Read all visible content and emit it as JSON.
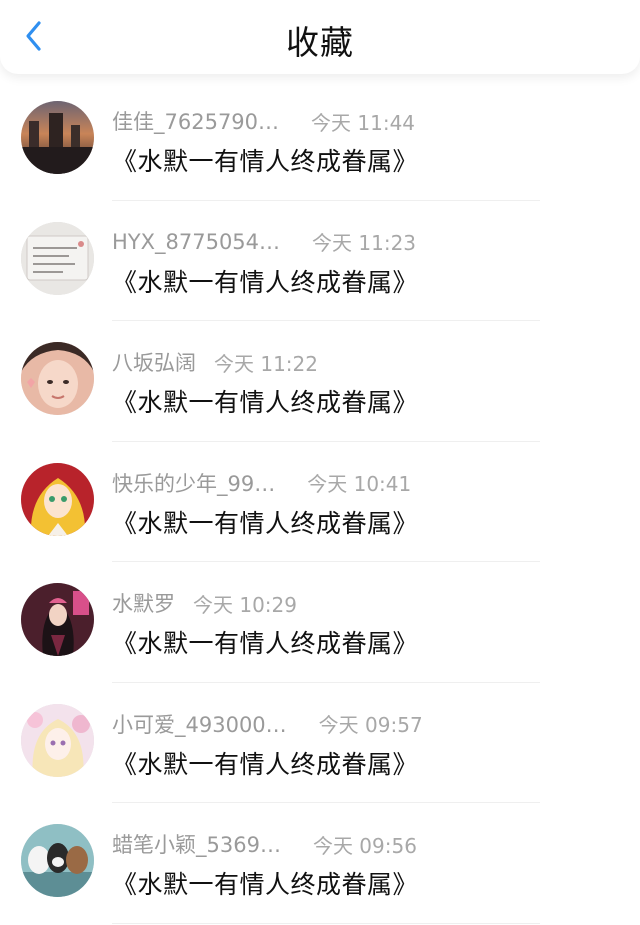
{
  "header": {
    "title": "收藏",
    "back_icon": "chevron-left-icon",
    "accent": "#2f8ff0"
  },
  "items": [
    {
      "user": "佳佳_7625790…",
      "time": "今天 11:44",
      "title": "《水默一有情人终成眷属》",
      "avatar": "sunset-city-avatar"
    },
    {
      "user": "HYX_8775054…",
      "time": "今天 11:23",
      "title": "《水默一有情人终成眷属》",
      "avatar": "handwritten-note-avatar"
    },
    {
      "user": "八坂弘阔",
      "time": "今天 11:22",
      "title": "《水默一有情人终成眷属》",
      "avatar": "girl-photo-avatar"
    },
    {
      "user": "快乐的少年_99…",
      "time": "今天 10:41",
      "title": "《水默一有情人终成眷属》",
      "avatar": "anime-blonde-avatar"
    },
    {
      "user": "水默罗",
      "time": "今天 10:29",
      "title": "《水默一有情人终成眷属》",
      "avatar": "doll-dark-avatar"
    },
    {
      "user": "小可爱_493000…",
      "time": "今天 09:57",
      "title": "《水默一有情人终成眷属》",
      "avatar": "anime-pink-avatar"
    },
    {
      "user": "蜡笔小颖_5369…",
      "time": "今天 09:56",
      "title": "《水默一有情人终成眷属》",
      "avatar": "bears-cartoon-avatar"
    }
  ]
}
